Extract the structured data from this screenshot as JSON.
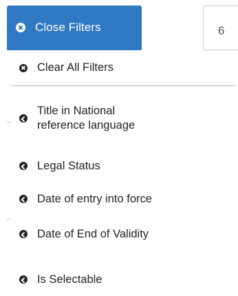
{
  "close_filters": {
    "label": "Close Filters",
    "icon": "close-circle-icon",
    "color": "#2f79c3"
  },
  "side_box": {
    "text": "6"
  },
  "filters_panel": {
    "clear_all": {
      "label": "Clear All Filters",
      "icon": "close-circle-icon"
    },
    "items": [
      {
        "label_line1": "Title in National",
        "label_line2": "reference language",
        "icon": "chevron-left-circle-icon"
      },
      {
        "label": "Legal Status",
        "icon": "chevron-left-circle-icon"
      },
      {
        "label": "Date of entry into force",
        "icon": "chevron-left-circle-icon"
      },
      {
        "label": "Date of End of Validity",
        "icon": "chevron-left-circle-icon"
      },
      {
        "label": "Is Selectable",
        "icon": "chevron-left-circle-icon"
      }
    ]
  }
}
